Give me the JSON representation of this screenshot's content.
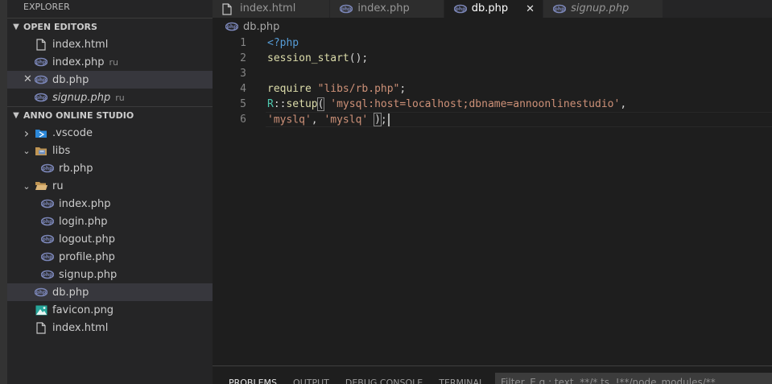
{
  "sidebar": {
    "title": "EXPLORER",
    "open_editors": {
      "header": "OPEN EDITORS",
      "items": [
        {
          "label": "index.html",
          "icon": "file-icon",
          "desc": ""
        },
        {
          "label": "index.php",
          "icon": "php-icon",
          "desc": "ru"
        },
        {
          "label": "db.php",
          "icon": "php-icon",
          "desc": "",
          "selected": true,
          "close": "✕"
        },
        {
          "label": "signup.php",
          "icon": "php-icon",
          "desc": "ru",
          "italic": true
        }
      ]
    },
    "project": {
      "header": "ANNO ONLINE STUDIO",
      "items": [
        {
          "label": ".vscode",
          "icon": "vscode-folder-icon",
          "depth": 0,
          "chevron": "›"
        },
        {
          "label": "libs",
          "icon": "libs-folder-icon",
          "depth": 0,
          "chevron": "⌄"
        },
        {
          "label": "rb.php",
          "icon": "php-icon",
          "depth": 1
        },
        {
          "label": "ru",
          "icon": "folder-open-icon",
          "depth": 0,
          "chevron": "⌄"
        },
        {
          "label": "index.php",
          "icon": "php-icon",
          "depth": 1
        },
        {
          "label": "login.php",
          "icon": "php-icon",
          "depth": 1
        },
        {
          "label": "logout.php",
          "icon": "php-icon",
          "depth": 1
        },
        {
          "label": "profile.php",
          "icon": "php-icon",
          "depth": 1
        },
        {
          "label": "signup.php",
          "icon": "php-icon",
          "depth": 1
        },
        {
          "label": "db.php",
          "icon": "php-icon",
          "depth": 0,
          "selected": true
        },
        {
          "label": "favicon.png",
          "icon": "image-icon",
          "depth": 0
        },
        {
          "label": "index.html",
          "icon": "file-icon",
          "depth": 0
        }
      ]
    }
  },
  "tabs": [
    {
      "label": "index.html",
      "icon": "file-icon"
    },
    {
      "label": "index.php",
      "icon": "php-icon"
    },
    {
      "label": "db.php",
      "icon": "php-icon",
      "active": true,
      "close": "✕"
    },
    {
      "label": "signup.php",
      "icon": "php-icon",
      "italic": true
    }
  ],
  "breadcrumb": {
    "file": "db.php"
  },
  "editor": {
    "current_line": 6,
    "lines": [
      {
        "num": "1",
        "tokens": [
          {
            "t": "<?php",
            "c": "kw"
          }
        ]
      },
      {
        "num": "2",
        "tokens": [
          {
            "t": "session_start",
            "c": "fn"
          },
          {
            "t": "();",
            "c": "plain"
          }
        ]
      },
      {
        "num": "3",
        "tokens": []
      },
      {
        "num": "4",
        "tokens": [
          {
            "t": "require ",
            "c": "fn"
          },
          {
            "t": "\"libs/rb.php\"",
            "c": "str"
          },
          {
            "t": ";",
            "c": "plain"
          }
        ]
      },
      {
        "num": "5",
        "tokens": [
          {
            "t": "R",
            "c": "cls"
          },
          {
            "t": "::",
            "c": "plain"
          },
          {
            "t": "setup",
            "c": "fn"
          },
          {
            "t": "(",
            "c": "plain",
            "bracket": true
          },
          {
            "t": " ",
            "c": "plain"
          },
          {
            "t": "'mysql:host=localhost;dbname=annoonlinestudio'",
            "c": "str"
          },
          {
            "t": ",",
            "c": "plain"
          }
        ]
      },
      {
        "num": "6",
        "tokens": [
          {
            "t": "'myslq'",
            "c": "str"
          },
          {
            "t": ", ",
            "c": "plain"
          },
          {
            "t": "'myslq'",
            "c": "str"
          },
          {
            "t": " ",
            "c": "plain"
          },
          {
            "t": ")",
            "c": "plain",
            "bracket": true
          },
          {
            "t": ";",
            "c": "plain"
          }
        ]
      }
    ]
  },
  "panel": {
    "tabs": [
      {
        "label": "PROBLEMS",
        "active": true
      },
      {
        "label": "OUTPUT"
      },
      {
        "label": "DEBUG CONSOLE"
      },
      {
        "label": "TERMINAL"
      }
    ],
    "filter_placeholder": "Filter. E.g.: text, **/*.ts, !**/node_modules/**"
  },
  "colors": {
    "php_icon": "#7b86b8",
    "vscode_icon": "#2c88d9",
    "folder_icon": "#c09553",
    "image_icon": "#26a69a"
  }
}
